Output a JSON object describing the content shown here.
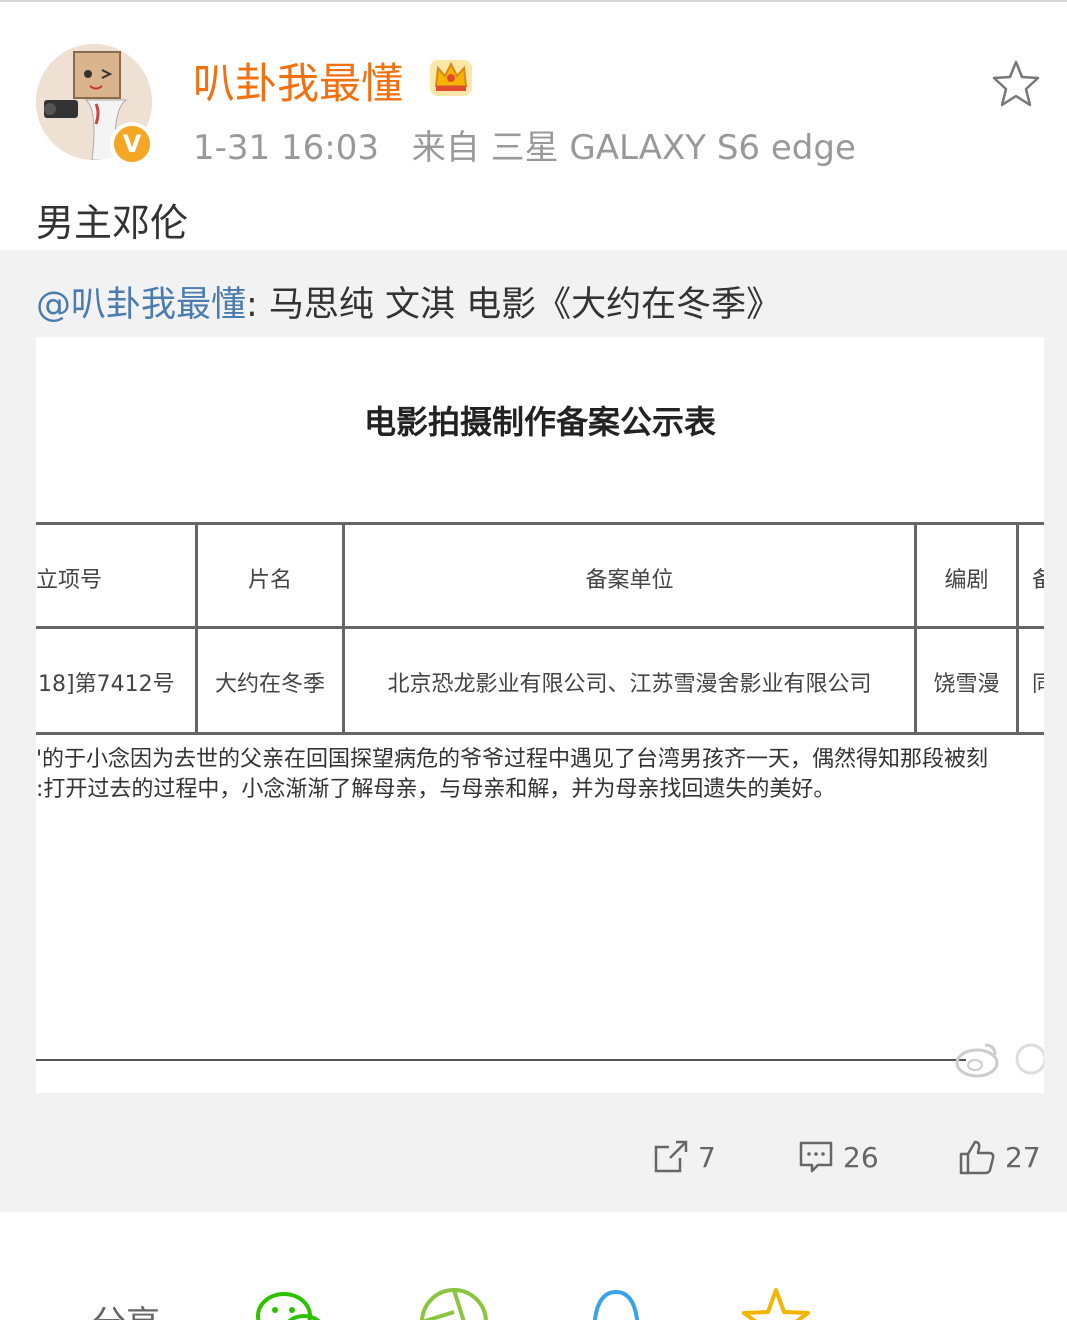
{
  "post": {
    "username": "叭卦我最懂",
    "timestamp": "1-31 16:03",
    "source": "来自 三星 GALAXY S6 edge",
    "text": "男主邓伦",
    "verified_badge": "V"
  },
  "repost": {
    "mention": "@叭卦我最懂",
    "text": ": 马思纯 文淇 电影《大约在冬季》"
  },
  "document": {
    "title": "电影拍摄制作备案公示表",
    "headers": [
      "立项号",
      "片名",
      "备案单位",
      "编剧",
      "备"
    ],
    "row": [
      "18]第7412号",
      "大约在冬季",
      "北京恐龙影业有限公司、江苏雪漫舍影业有限公司",
      "饶雪漫",
      "同"
    ],
    "paragraph_line1": "'的于小念因为去世的父亲在回国探望病危的爷爷过程中遇见了台湾男孩齐一天，偶然得知那段被刻",
    "paragraph_line2": ":打开过去的过程中，小念渐渐了解母亲，与母亲和解，并为母亲找回遗失的美好。"
  },
  "actions": {
    "repost_count": "7",
    "comment_count": "26",
    "like_count": "27"
  },
  "share": {
    "label": "分享"
  },
  "colors": {
    "username": "#f2700f",
    "mention": "#4a7cb0",
    "repost_bg": "#f2f2f2",
    "badge": "#f5a623"
  }
}
